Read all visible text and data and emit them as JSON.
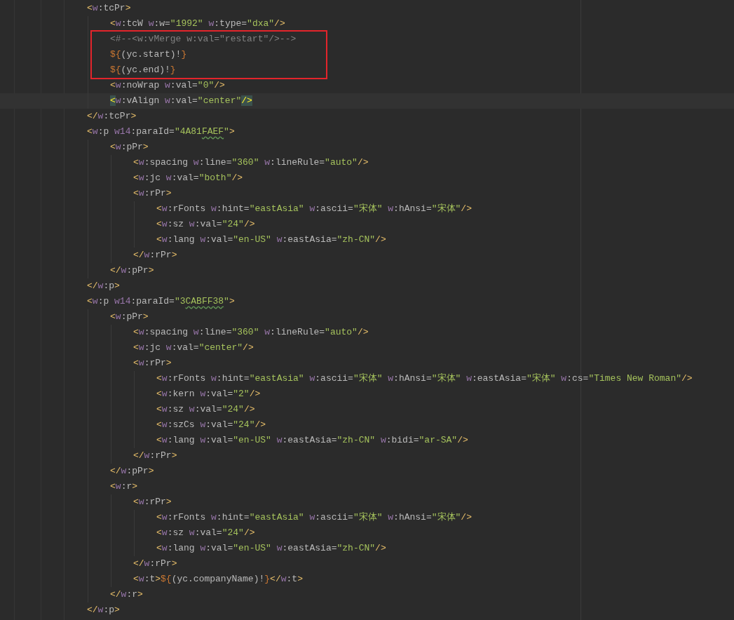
{
  "editor": {
    "lines": [
      {
        "kind": "line",
        "tokens": [
          {
            "kind": "bracket",
            "text": "<"
          },
          {
            "kind": "ns",
            "text": "w"
          },
          {
            "kind": "name",
            "text": ":tcPr"
          },
          {
            "kind": "bracket",
            "text": ">"
          }
        ],
        "children": [
          {
            "kind": "line",
            "tokens": [
              {
                "kind": "bracket",
                "text": "<"
              },
              {
                "kind": "ns",
                "text": "w"
              },
              {
                "kind": "name",
                "text": ":tcW"
              },
              {
                "kind": "ns",
                "text": " w"
              },
              {
                "kind": "name",
                "text": ":w="
              },
              {
                "kind": "str",
                "text": "\"1992\""
              },
              {
                "kind": "ns",
                "text": " w"
              },
              {
                "kind": "name",
                "text": ":type="
              },
              {
                "kind": "str",
                "text": "\"dxa\""
              },
              {
                "kind": "bracket",
                "text": "/>"
              }
            ]
          },
          {
            "kind": "box",
            "lines": [
              {
                "kind": "line",
                "tokens": [
                  {
                    "kind": "comment",
                    "text": "<#--<w:vMerge w:val=\"restart\"/>-->"
                  }
                ]
              },
              {
                "kind": "line",
                "tokens": [
                  {
                    "kind": "interp",
                    "text": "${"
                  },
                  {
                    "kind": "name",
                    "text": "(yc.start)!"
                  },
                  {
                    "kind": "interp",
                    "text": "}"
                  }
                ]
              },
              {
                "kind": "line",
                "tokens": [
                  {
                    "kind": "interp",
                    "text": "${"
                  },
                  {
                    "kind": "name",
                    "text": "(yc.end)!"
                  },
                  {
                    "kind": "interp",
                    "text": "}"
                  }
                ]
              }
            ]
          },
          {
            "kind": "line",
            "tokens": [
              {
                "kind": "bracket",
                "text": "<"
              },
              {
                "kind": "ns",
                "text": "w"
              },
              {
                "kind": "name",
                "text": ":noWrap"
              },
              {
                "kind": "ns",
                "text": " w"
              },
              {
                "kind": "name",
                "text": ":val="
              },
              {
                "kind": "str",
                "text": "\"0\""
              },
              {
                "kind": "bracket",
                "text": "/>"
              }
            ]
          },
          {
            "kind": "line",
            "tokens": [
              {
                "kind": "match",
                "text": "<"
              },
              {
                "kind": "ns",
                "text": "w"
              },
              {
                "kind": "name",
                "text": ":vAlign"
              },
              {
                "kind": "ns",
                "text": " w"
              },
              {
                "kind": "name",
                "text": ":val="
              },
              {
                "kind": "str",
                "text": "\"center\""
              },
              {
                "kind": "match",
                "text": "/>"
              }
            ]
          }
        ]
      },
      {
        "kind": "line",
        "tokens": [
          {
            "kind": "bracket",
            "text": "</"
          },
          {
            "kind": "ns",
            "text": "w"
          },
          {
            "kind": "name",
            "text": ":tcPr"
          },
          {
            "kind": "bracket",
            "text": ">"
          }
        ]
      },
      {
        "kind": "line",
        "tokens": [
          {
            "kind": "bracket",
            "text": "<"
          },
          {
            "kind": "ns",
            "text": "w"
          },
          {
            "kind": "name",
            "text": ":p"
          },
          {
            "kind": "ns",
            "text": " w14"
          },
          {
            "kind": "name",
            "text": ":paraId="
          },
          {
            "kind": "str",
            "text": "\"4A81"
          },
          {
            "kind": "typo",
            "text": "FAEF"
          },
          {
            "kind": "str",
            "text": "\""
          },
          {
            "kind": "bracket",
            "text": ">"
          }
        ],
        "children": [
          {
            "kind": "line",
            "tokens": [
              {
                "kind": "bracket",
                "text": "<"
              },
              {
                "kind": "ns",
                "text": "w"
              },
              {
                "kind": "name",
                "text": ":pPr"
              },
              {
                "kind": "bracket",
                "text": ">"
              }
            ],
            "children": [
              {
                "kind": "line",
                "tokens": [
                  {
                    "kind": "bracket",
                    "text": "<"
                  },
                  {
                    "kind": "ns",
                    "text": "w"
                  },
                  {
                    "kind": "name",
                    "text": ":spacing"
                  },
                  {
                    "kind": "ns",
                    "text": " w"
                  },
                  {
                    "kind": "name",
                    "text": ":line="
                  },
                  {
                    "kind": "str",
                    "text": "\"360\""
                  },
                  {
                    "kind": "ns",
                    "text": " w"
                  },
                  {
                    "kind": "name",
                    "text": ":lineRule="
                  },
                  {
                    "kind": "str",
                    "text": "\"auto\""
                  },
                  {
                    "kind": "bracket",
                    "text": "/>"
                  }
                ]
              },
              {
                "kind": "line",
                "tokens": [
                  {
                    "kind": "bracket",
                    "text": "<"
                  },
                  {
                    "kind": "ns",
                    "text": "w"
                  },
                  {
                    "kind": "name",
                    "text": ":jc"
                  },
                  {
                    "kind": "ns",
                    "text": " w"
                  },
                  {
                    "kind": "name",
                    "text": ":val="
                  },
                  {
                    "kind": "str",
                    "text": "\"both\""
                  },
                  {
                    "kind": "bracket",
                    "text": "/>"
                  }
                ]
              },
              {
                "kind": "line",
                "tokens": [
                  {
                    "kind": "bracket",
                    "text": "<"
                  },
                  {
                    "kind": "ns",
                    "text": "w"
                  },
                  {
                    "kind": "name",
                    "text": ":rPr"
                  },
                  {
                    "kind": "bracket",
                    "text": ">"
                  }
                ],
                "children": [
                  {
                    "kind": "line",
                    "tokens": [
                      {
                        "kind": "bracket",
                        "text": "<"
                      },
                      {
                        "kind": "ns",
                        "text": "w"
                      },
                      {
                        "kind": "name",
                        "text": ":rFonts"
                      },
                      {
                        "kind": "ns",
                        "text": " w"
                      },
                      {
                        "kind": "name",
                        "text": ":hint="
                      },
                      {
                        "kind": "str",
                        "text": "\"eastAsia\""
                      },
                      {
                        "kind": "ns",
                        "text": " w"
                      },
                      {
                        "kind": "name",
                        "text": ":ascii="
                      },
                      {
                        "kind": "str",
                        "text": "\"宋体\""
                      },
                      {
                        "kind": "ns",
                        "text": " w"
                      },
                      {
                        "kind": "name",
                        "text": ":hAnsi="
                      },
                      {
                        "kind": "str",
                        "text": "\"宋体\""
                      },
                      {
                        "kind": "bracket",
                        "text": "/>"
                      }
                    ]
                  },
                  {
                    "kind": "line",
                    "tokens": [
                      {
                        "kind": "bracket",
                        "text": "<"
                      },
                      {
                        "kind": "ns",
                        "text": "w"
                      },
                      {
                        "kind": "name",
                        "text": ":sz"
                      },
                      {
                        "kind": "ns",
                        "text": " w"
                      },
                      {
                        "kind": "name",
                        "text": ":val="
                      },
                      {
                        "kind": "str",
                        "text": "\"24\""
                      },
                      {
                        "kind": "bracket",
                        "text": "/>"
                      }
                    ]
                  },
                  {
                    "kind": "line",
                    "tokens": [
                      {
                        "kind": "bracket",
                        "text": "<"
                      },
                      {
                        "kind": "ns",
                        "text": "w"
                      },
                      {
                        "kind": "name",
                        "text": ":lang"
                      },
                      {
                        "kind": "ns",
                        "text": " w"
                      },
                      {
                        "kind": "name",
                        "text": ":val="
                      },
                      {
                        "kind": "str",
                        "text": "\"en-US\""
                      },
                      {
                        "kind": "ns",
                        "text": " w"
                      },
                      {
                        "kind": "name",
                        "text": ":eastAsia="
                      },
                      {
                        "kind": "str",
                        "text": "\"zh-CN\""
                      },
                      {
                        "kind": "bracket",
                        "text": "/>"
                      }
                    ]
                  }
                ]
              },
              {
                "kind": "line",
                "tokens": [
                  {
                    "kind": "bracket",
                    "text": "</"
                  },
                  {
                    "kind": "ns",
                    "text": "w"
                  },
                  {
                    "kind": "name",
                    "text": ":rPr"
                  },
                  {
                    "kind": "bracket",
                    "text": ">"
                  }
                ]
              }
            ]
          },
          {
            "kind": "line",
            "tokens": [
              {
                "kind": "bracket",
                "text": "</"
              },
              {
                "kind": "ns",
                "text": "w"
              },
              {
                "kind": "name",
                "text": ":pPr"
              },
              {
                "kind": "bracket",
                "text": ">"
              }
            ]
          }
        ]
      },
      {
        "kind": "line",
        "tokens": [
          {
            "kind": "bracket",
            "text": "</"
          },
          {
            "kind": "ns",
            "text": "w"
          },
          {
            "kind": "name",
            "text": ":p"
          },
          {
            "kind": "bracket",
            "text": ">"
          }
        ]
      },
      {
        "kind": "line",
        "tokens": [
          {
            "kind": "bracket",
            "text": "<"
          },
          {
            "kind": "ns",
            "text": "w"
          },
          {
            "kind": "name",
            "text": ":p"
          },
          {
            "kind": "ns",
            "text": " w14"
          },
          {
            "kind": "name",
            "text": ":paraId="
          },
          {
            "kind": "str",
            "text": "\"3"
          },
          {
            "kind": "typo",
            "text": "CABFF38"
          },
          {
            "kind": "str",
            "text": "\""
          },
          {
            "kind": "bracket",
            "text": ">"
          }
        ],
        "children": [
          {
            "kind": "line",
            "tokens": [
              {
                "kind": "bracket",
                "text": "<"
              },
              {
                "kind": "ns",
                "text": "w"
              },
              {
                "kind": "name",
                "text": ":pPr"
              },
              {
                "kind": "bracket",
                "text": ">"
              }
            ],
            "children": [
              {
                "kind": "line",
                "tokens": [
                  {
                    "kind": "bracket",
                    "text": "<"
                  },
                  {
                    "kind": "ns",
                    "text": "w"
                  },
                  {
                    "kind": "name",
                    "text": ":spacing"
                  },
                  {
                    "kind": "ns",
                    "text": " w"
                  },
                  {
                    "kind": "name",
                    "text": ":line="
                  },
                  {
                    "kind": "str",
                    "text": "\"360\""
                  },
                  {
                    "kind": "ns",
                    "text": " w"
                  },
                  {
                    "kind": "name",
                    "text": ":lineRule="
                  },
                  {
                    "kind": "str",
                    "text": "\"auto\""
                  },
                  {
                    "kind": "bracket",
                    "text": "/>"
                  }
                ]
              },
              {
                "kind": "line",
                "tokens": [
                  {
                    "kind": "bracket",
                    "text": "<"
                  },
                  {
                    "kind": "ns",
                    "text": "w"
                  },
                  {
                    "kind": "name",
                    "text": ":jc"
                  },
                  {
                    "kind": "ns",
                    "text": " w"
                  },
                  {
                    "kind": "name",
                    "text": ":val="
                  },
                  {
                    "kind": "str",
                    "text": "\"center\""
                  },
                  {
                    "kind": "bracket",
                    "text": "/>"
                  }
                ]
              },
              {
                "kind": "line",
                "tokens": [
                  {
                    "kind": "bracket",
                    "text": "<"
                  },
                  {
                    "kind": "ns",
                    "text": "w"
                  },
                  {
                    "kind": "name",
                    "text": ":rPr"
                  },
                  {
                    "kind": "bracket",
                    "text": ">"
                  }
                ],
                "children": [
                  {
                    "kind": "line",
                    "tokens": [
                      {
                        "kind": "bracket",
                        "text": "<"
                      },
                      {
                        "kind": "ns",
                        "text": "w"
                      },
                      {
                        "kind": "name",
                        "text": ":rFonts"
                      },
                      {
                        "kind": "ns",
                        "text": " w"
                      },
                      {
                        "kind": "name",
                        "text": ":hint="
                      },
                      {
                        "kind": "str",
                        "text": "\"eastAsia\""
                      },
                      {
                        "kind": "ns",
                        "text": " w"
                      },
                      {
                        "kind": "name",
                        "text": ":ascii="
                      },
                      {
                        "kind": "str",
                        "text": "\"宋体\""
                      },
                      {
                        "kind": "ns",
                        "text": " w"
                      },
                      {
                        "kind": "name",
                        "text": ":hAnsi="
                      },
                      {
                        "kind": "str",
                        "text": "\"宋体\""
                      },
                      {
                        "kind": "ns",
                        "text": " w"
                      },
                      {
                        "kind": "name",
                        "text": ":eastAsia="
                      },
                      {
                        "kind": "str",
                        "text": "\"宋体\""
                      },
                      {
                        "kind": "ns",
                        "text": " w"
                      },
                      {
                        "kind": "name",
                        "text": ":cs="
                      },
                      {
                        "kind": "str",
                        "text": "\"Times New Roman\""
                      },
                      {
                        "kind": "bracket",
                        "text": "/>"
                      }
                    ]
                  },
                  {
                    "kind": "line",
                    "tokens": [
                      {
                        "kind": "bracket",
                        "text": "<"
                      },
                      {
                        "kind": "ns",
                        "text": "w"
                      },
                      {
                        "kind": "name",
                        "text": ":kern"
                      },
                      {
                        "kind": "ns",
                        "text": " w"
                      },
                      {
                        "kind": "name",
                        "text": ":val="
                      },
                      {
                        "kind": "str",
                        "text": "\"2\""
                      },
                      {
                        "kind": "bracket",
                        "text": "/>"
                      }
                    ]
                  },
                  {
                    "kind": "line",
                    "tokens": [
                      {
                        "kind": "bracket",
                        "text": "<"
                      },
                      {
                        "kind": "ns",
                        "text": "w"
                      },
                      {
                        "kind": "name",
                        "text": ":sz"
                      },
                      {
                        "kind": "ns",
                        "text": " w"
                      },
                      {
                        "kind": "name",
                        "text": ":val="
                      },
                      {
                        "kind": "str",
                        "text": "\"24\""
                      },
                      {
                        "kind": "bracket",
                        "text": "/>"
                      }
                    ]
                  },
                  {
                    "kind": "line",
                    "tokens": [
                      {
                        "kind": "bracket",
                        "text": "<"
                      },
                      {
                        "kind": "ns",
                        "text": "w"
                      },
                      {
                        "kind": "name",
                        "text": ":szCs"
                      },
                      {
                        "kind": "ns",
                        "text": " w"
                      },
                      {
                        "kind": "name",
                        "text": ":val="
                      },
                      {
                        "kind": "str",
                        "text": "\"24\""
                      },
                      {
                        "kind": "bracket",
                        "text": "/>"
                      }
                    ]
                  },
                  {
                    "kind": "line",
                    "tokens": [
                      {
                        "kind": "bracket",
                        "text": "<"
                      },
                      {
                        "kind": "ns",
                        "text": "w"
                      },
                      {
                        "kind": "name",
                        "text": ":lang"
                      },
                      {
                        "kind": "ns",
                        "text": " w"
                      },
                      {
                        "kind": "name",
                        "text": ":val="
                      },
                      {
                        "kind": "str",
                        "text": "\"en-US\""
                      },
                      {
                        "kind": "ns",
                        "text": " w"
                      },
                      {
                        "kind": "name",
                        "text": ":eastAsia="
                      },
                      {
                        "kind": "str",
                        "text": "\"zh-CN\""
                      },
                      {
                        "kind": "ns",
                        "text": " w"
                      },
                      {
                        "kind": "name",
                        "text": ":bidi="
                      },
                      {
                        "kind": "str",
                        "text": "\"ar-SA\""
                      },
                      {
                        "kind": "bracket",
                        "text": "/>"
                      }
                    ]
                  }
                ]
              },
              {
                "kind": "line",
                "tokens": [
                  {
                    "kind": "bracket",
                    "text": "</"
                  },
                  {
                    "kind": "ns",
                    "text": "w"
                  },
                  {
                    "kind": "name",
                    "text": ":rPr"
                  },
                  {
                    "kind": "bracket",
                    "text": ">"
                  }
                ]
              }
            ]
          },
          {
            "kind": "line",
            "tokens": [
              {
                "kind": "bracket",
                "text": "</"
              },
              {
                "kind": "ns",
                "text": "w"
              },
              {
                "kind": "name",
                "text": ":pPr"
              },
              {
                "kind": "bracket",
                "text": ">"
              }
            ]
          },
          {
            "kind": "line",
            "tokens": [
              {
                "kind": "bracket",
                "text": "<"
              },
              {
                "kind": "ns",
                "text": "w"
              },
              {
                "kind": "name",
                "text": ":r"
              },
              {
                "kind": "bracket",
                "text": ">"
              }
            ],
            "children": [
              {
                "kind": "line",
                "tokens": [
                  {
                    "kind": "bracket",
                    "text": "<"
                  },
                  {
                    "kind": "ns",
                    "text": "w"
                  },
                  {
                    "kind": "name",
                    "text": ":rPr"
                  },
                  {
                    "kind": "bracket",
                    "text": ">"
                  }
                ],
                "children": [
                  {
                    "kind": "line",
                    "tokens": [
                      {
                        "kind": "bracket",
                        "text": "<"
                      },
                      {
                        "kind": "ns",
                        "text": "w"
                      },
                      {
                        "kind": "name",
                        "text": ":rFonts"
                      },
                      {
                        "kind": "ns",
                        "text": " w"
                      },
                      {
                        "kind": "name",
                        "text": ":hint="
                      },
                      {
                        "kind": "str",
                        "text": "\"eastAsia\""
                      },
                      {
                        "kind": "ns",
                        "text": " w"
                      },
                      {
                        "kind": "name",
                        "text": ":ascii="
                      },
                      {
                        "kind": "str",
                        "text": "\"宋体\""
                      },
                      {
                        "kind": "ns",
                        "text": " w"
                      },
                      {
                        "kind": "name",
                        "text": ":hAnsi="
                      },
                      {
                        "kind": "str",
                        "text": "\"宋体\""
                      },
                      {
                        "kind": "bracket",
                        "text": "/>"
                      }
                    ]
                  },
                  {
                    "kind": "line",
                    "tokens": [
                      {
                        "kind": "bracket",
                        "text": "<"
                      },
                      {
                        "kind": "ns",
                        "text": "w"
                      },
                      {
                        "kind": "name",
                        "text": ":sz"
                      },
                      {
                        "kind": "ns",
                        "text": " w"
                      },
                      {
                        "kind": "name",
                        "text": ":val="
                      },
                      {
                        "kind": "str",
                        "text": "\"24\""
                      },
                      {
                        "kind": "bracket",
                        "text": "/>"
                      }
                    ]
                  },
                  {
                    "kind": "line",
                    "tokens": [
                      {
                        "kind": "bracket",
                        "text": "<"
                      },
                      {
                        "kind": "ns",
                        "text": "w"
                      },
                      {
                        "kind": "name",
                        "text": ":lang"
                      },
                      {
                        "kind": "ns",
                        "text": " w"
                      },
                      {
                        "kind": "name",
                        "text": ":val="
                      },
                      {
                        "kind": "str",
                        "text": "\"en-US\""
                      },
                      {
                        "kind": "ns",
                        "text": " w"
                      },
                      {
                        "kind": "name",
                        "text": ":eastAsia="
                      },
                      {
                        "kind": "str",
                        "text": "\"zh-CN\""
                      },
                      {
                        "kind": "bracket",
                        "text": "/>"
                      }
                    ]
                  }
                ]
              },
              {
                "kind": "line",
                "tokens": [
                  {
                    "kind": "bracket",
                    "text": "</"
                  },
                  {
                    "kind": "ns",
                    "text": "w"
                  },
                  {
                    "kind": "name",
                    "text": ":rPr"
                  },
                  {
                    "kind": "bracket",
                    "text": ">"
                  }
                ]
              },
              {
                "kind": "line",
                "tokens": [
                  {
                    "kind": "bracket",
                    "text": "<"
                  },
                  {
                    "kind": "ns",
                    "text": "w"
                  },
                  {
                    "kind": "name",
                    "text": ":t"
                  },
                  {
                    "kind": "bracket",
                    "text": ">"
                  },
                  {
                    "kind": "interp",
                    "text": "${"
                  },
                  {
                    "kind": "name",
                    "text": "(yc.companyName)!"
                  },
                  {
                    "kind": "interp",
                    "text": "}"
                  },
                  {
                    "kind": "bracket",
                    "text": "</"
                  },
                  {
                    "kind": "ns",
                    "text": "w"
                  },
                  {
                    "kind": "name",
                    "text": ":t"
                  },
                  {
                    "kind": "bracket",
                    "text": ">"
                  }
                ]
              }
            ]
          },
          {
            "kind": "line",
            "tokens": [
              {
                "kind": "bracket",
                "text": "</"
              },
              {
                "kind": "ns",
                "text": "w"
              },
              {
                "kind": "name",
                "text": ":r"
              },
              {
                "kind": "bracket",
                "text": ">"
              }
            ]
          }
        ]
      },
      {
        "kind": "line",
        "tokens": [
          {
            "kind": "bracket",
            "text": "</"
          },
          {
            "kind": "ns",
            "text": "w"
          },
          {
            "kind": "name",
            "text": ":p"
          },
          {
            "kind": "bracket",
            "text": ">"
          }
        ]
      }
    ]
  }
}
